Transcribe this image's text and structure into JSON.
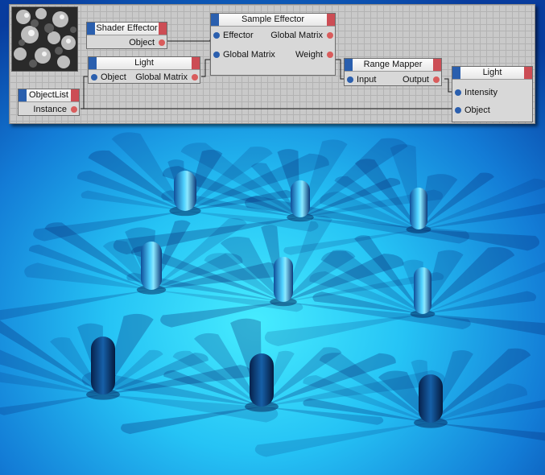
{
  "xpresso_editor": {
    "nodes": {
      "shader_effector": {
        "title": "Shader Effector",
        "ports": {
          "object_out": "Object"
        }
      },
      "light_a": {
        "title": "Light",
        "ports": {
          "object_in": "Object",
          "global_matrix_out": "Global Matrix"
        }
      },
      "object_list": {
        "title": "ObjectList",
        "ports": {
          "instance_out": "Instance"
        }
      },
      "sample_effector": {
        "title": "Sample Effector",
        "ports": {
          "effector_in": "Effector",
          "global_matrix_in": "Global Matrix",
          "global_matrix_out": "Global Matrix",
          "weight_out": "Weight"
        }
      },
      "range_mapper": {
        "title": "Range Mapper",
        "ports": {
          "input_in": "Input",
          "output_out": "Output"
        }
      },
      "light_b": {
        "title": "Light",
        "ports": {
          "intensity_in": "Intensity",
          "object_in": "Object"
        }
      }
    },
    "colors": {
      "input_port": "#2b5fae",
      "output_port": "#d95c5c",
      "header_left": "#2a5fae",
      "header_right": "#cc4d55",
      "grid_background": "#c9c9c9"
    }
  },
  "viewport": {
    "description_icon": "render-view",
    "background_colors": [
      "#40e8ff",
      "#1aa7ec",
      "#0a3f9c"
    ]
  }
}
